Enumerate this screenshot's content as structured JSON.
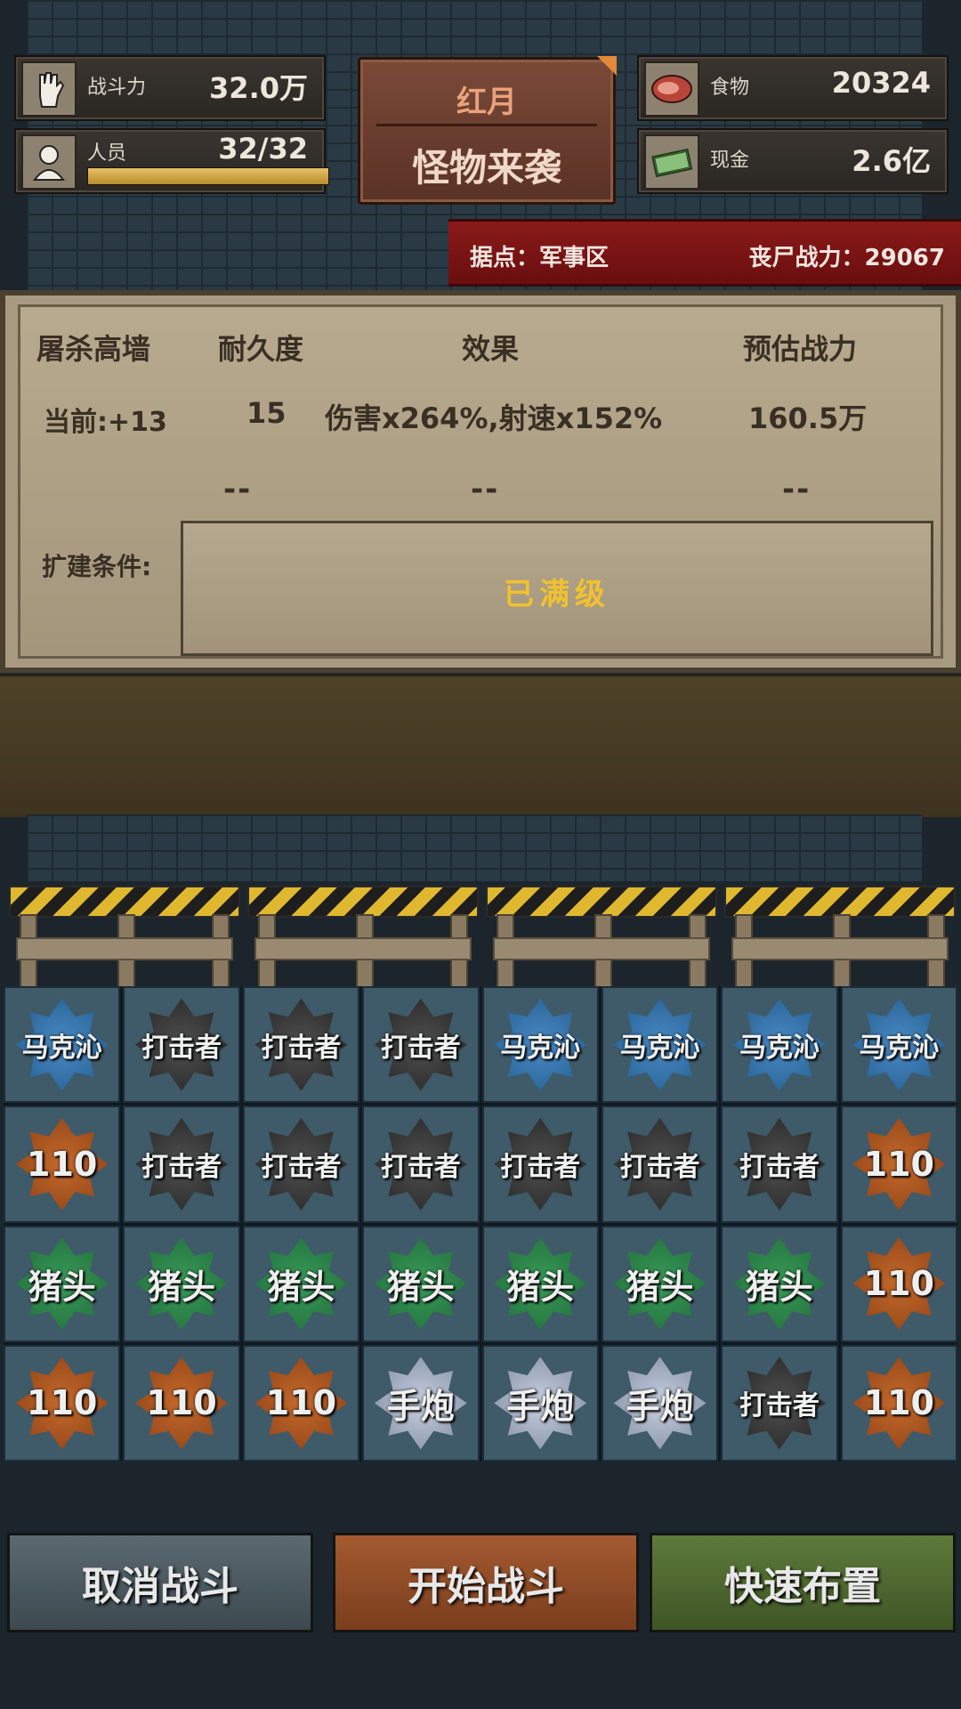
{
  "resources": {
    "combat_power": {
      "label": "战斗力",
      "value": "32.0万",
      "icon": "fist-icon"
    },
    "personnel": {
      "label": "人员",
      "value": "32/32",
      "icon": "person-icon",
      "fill_fraction": 1.0
    },
    "food": {
      "label": "食物",
      "value": "20324",
      "icon": "meat-icon"
    },
    "cash": {
      "label": "现金",
      "value": "2.6亿",
      "icon": "cash-icon"
    }
  },
  "event": {
    "top": "红月",
    "main": "怪物来袭"
  },
  "stronghold": {
    "location": "据点：军事区",
    "zombie_power": "丧尸战力：29067"
  },
  "wall_panel": {
    "headers": [
      "屠杀高墙",
      "耐久度",
      "效果",
      "预估战力"
    ],
    "current": {
      "level": "当前:+13",
      "durability": "15",
      "effect": "伤害x264%,射速x152%",
      "power": "160.5万"
    },
    "next": {
      "durability": "--",
      "effect": "--",
      "power": "--"
    },
    "expand_label": "扩建条件:",
    "expand_status": "已满级"
  },
  "grid": [
    [
      {
        "t": "马克沁",
        "c": "blue"
      },
      {
        "t": "打击者",
        "c": "black"
      },
      {
        "t": "打击者",
        "c": "black"
      },
      {
        "t": "打击者",
        "c": "black"
      },
      {
        "t": "马克沁",
        "c": "blue"
      },
      {
        "t": "马克沁",
        "c": "blue"
      },
      {
        "t": "马克沁",
        "c": "blue"
      },
      {
        "t": "马克沁",
        "c": "blue"
      }
    ],
    [
      {
        "t": "110",
        "c": "orange"
      },
      {
        "t": "打击者",
        "c": "black"
      },
      {
        "t": "打击者",
        "c": "black"
      },
      {
        "t": "打击者",
        "c": "black"
      },
      {
        "t": "打击者",
        "c": "black"
      },
      {
        "t": "打击者",
        "c": "black"
      },
      {
        "t": "打击者",
        "c": "black"
      },
      {
        "t": "110",
        "c": "orange"
      }
    ],
    [
      {
        "t": "猪头",
        "c": "green"
      },
      {
        "t": "猪头",
        "c": "green"
      },
      {
        "t": "猪头",
        "c": "green"
      },
      {
        "t": "猪头",
        "c": "green"
      },
      {
        "t": "猪头",
        "c": "green"
      },
      {
        "t": "猪头",
        "c": "green"
      },
      {
        "t": "猪头",
        "c": "green"
      },
      {
        "t": "110",
        "c": "orange"
      }
    ],
    [
      {
        "t": "110",
        "c": "orange"
      },
      {
        "t": "110",
        "c": "orange"
      },
      {
        "t": "110",
        "c": "orange"
      },
      {
        "t": "手炮",
        "c": "silver"
      },
      {
        "t": "手炮",
        "c": "silver"
      },
      {
        "t": "手炮",
        "c": "silver"
      },
      {
        "t": "打击者",
        "c": "black"
      },
      {
        "t": "110",
        "c": "orange"
      }
    ]
  ],
  "buttons": {
    "cancel": "取消战斗",
    "start": "开始战斗",
    "quick": "快速布置"
  }
}
